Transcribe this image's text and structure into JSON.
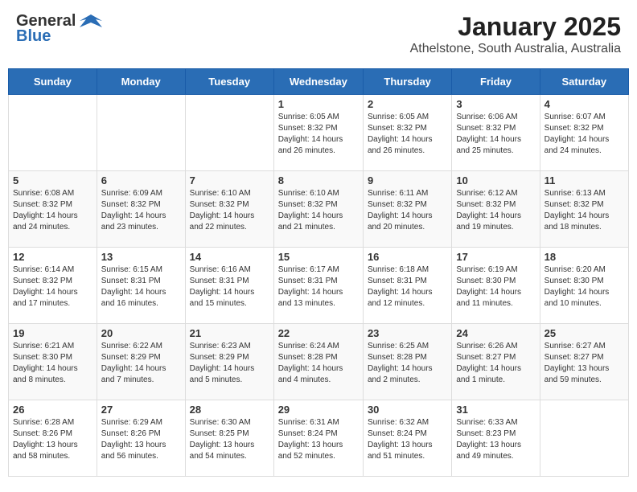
{
  "header": {
    "logo_general": "General",
    "logo_blue": "Blue",
    "month_title": "January 2025",
    "location": "Athelstone, South Australia, Australia"
  },
  "weekdays": [
    "Sunday",
    "Monday",
    "Tuesday",
    "Wednesday",
    "Thursday",
    "Friday",
    "Saturday"
  ],
  "weeks": [
    [
      {
        "day": null,
        "info": null
      },
      {
        "day": null,
        "info": null
      },
      {
        "day": null,
        "info": null
      },
      {
        "day": "1",
        "info": "Sunrise: 6:05 AM\nSunset: 8:32 PM\nDaylight: 14 hours\nand 26 minutes."
      },
      {
        "day": "2",
        "info": "Sunrise: 6:05 AM\nSunset: 8:32 PM\nDaylight: 14 hours\nand 26 minutes."
      },
      {
        "day": "3",
        "info": "Sunrise: 6:06 AM\nSunset: 8:32 PM\nDaylight: 14 hours\nand 25 minutes."
      },
      {
        "day": "4",
        "info": "Sunrise: 6:07 AM\nSunset: 8:32 PM\nDaylight: 14 hours\nand 24 minutes."
      }
    ],
    [
      {
        "day": "5",
        "info": "Sunrise: 6:08 AM\nSunset: 8:32 PM\nDaylight: 14 hours\nand 24 minutes."
      },
      {
        "day": "6",
        "info": "Sunrise: 6:09 AM\nSunset: 8:32 PM\nDaylight: 14 hours\nand 23 minutes."
      },
      {
        "day": "7",
        "info": "Sunrise: 6:10 AM\nSunset: 8:32 PM\nDaylight: 14 hours\nand 22 minutes."
      },
      {
        "day": "8",
        "info": "Sunrise: 6:10 AM\nSunset: 8:32 PM\nDaylight: 14 hours\nand 21 minutes."
      },
      {
        "day": "9",
        "info": "Sunrise: 6:11 AM\nSunset: 8:32 PM\nDaylight: 14 hours\nand 20 minutes."
      },
      {
        "day": "10",
        "info": "Sunrise: 6:12 AM\nSunset: 8:32 PM\nDaylight: 14 hours\nand 19 minutes."
      },
      {
        "day": "11",
        "info": "Sunrise: 6:13 AM\nSunset: 8:32 PM\nDaylight: 14 hours\nand 18 minutes."
      }
    ],
    [
      {
        "day": "12",
        "info": "Sunrise: 6:14 AM\nSunset: 8:32 PM\nDaylight: 14 hours\nand 17 minutes."
      },
      {
        "day": "13",
        "info": "Sunrise: 6:15 AM\nSunset: 8:31 PM\nDaylight: 14 hours\nand 16 minutes."
      },
      {
        "day": "14",
        "info": "Sunrise: 6:16 AM\nSunset: 8:31 PM\nDaylight: 14 hours\nand 15 minutes."
      },
      {
        "day": "15",
        "info": "Sunrise: 6:17 AM\nSunset: 8:31 PM\nDaylight: 14 hours\nand 13 minutes."
      },
      {
        "day": "16",
        "info": "Sunrise: 6:18 AM\nSunset: 8:31 PM\nDaylight: 14 hours\nand 12 minutes."
      },
      {
        "day": "17",
        "info": "Sunrise: 6:19 AM\nSunset: 8:30 PM\nDaylight: 14 hours\nand 11 minutes."
      },
      {
        "day": "18",
        "info": "Sunrise: 6:20 AM\nSunset: 8:30 PM\nDaylight: 14 hours\nand 10 minutes."
      }
    ],
    [
      {
        "day": "19",
        "info": "Sunrise: 6:21 AM\nSunset: 8:30 PM\nDaylight: 14 hours\nand 8 minutes."
      },
      {
        "day": "20",
        "info": "Sunrise: 6:22 AM\nSunset: 8:29 PM\nDaylight: 14 hours\nand 7 minutes."
      },
      {
        "day": "21",
        "info": "Sunrise: 6:23 AM\nSunset: 8:29 PM\nDaylight: 14 hours\nand 5 minutes."
      },
      {
        "day": "22",
        "info": "Sunrise: 6:24 AM\nSunset: 8:28 PM\nDaylight: 14 hours\nand 4 minutes."
      },
      {
        "day": "23",
        "info": "Sunrise: 6:25 AM\nSunset: 8:28 PM\nDaylight: 14 hours\nand 2 minutes."
      },
      {
        "day": "24",
        "info": "Sunrise: 6:26 AM\nSunset: 8:27 PM\nDaylight: 14 hours\nand 1 minute."
      },
      {
        "day": "25",
        "info": "Sunrise: 6:27 AM\nSunset: 8:27 PM\nDaylight: 13 hours\nand 59 minutes."
      }
    ],
    [
      {
        "day": "26",
        "info": "Sunrise: 6:28 AM\nSunset: 8:26 PM\nDaylight: 13 hours\nand 58 minutes."
      },
      {
        "day": "27",
        "info": "Sunrise: 6:29 AM\nSunset: 8:26 PM\nDaylight: 13 hours\nand 56 minutes."
      },
      {
        "day": "28",
        "info": "Sunrise: 6:30 AM\nSunset: 8:25 PM\nDaylight: 13 hours\nand 54 minutes."
      },
      {
        "day": "29",
        "info": "Sunrise: 6:31 AM\nSunset: 8:24 PM\nDaylight: 13 hours\nand 52 minutes."
      },
      {
        "day": "30",
        "info": "Sunrise: 6:32 AM\nSunset: 8:24 PM\nDaylight: 13 hours\nand 51 minutes."
      },
      {
        "day": "31",
        "info": "Sunrise: 6:33 AM\nSunset: 8:23 PM\nDaylight: 13 hours\nand 49 minutes."
      },
      {
        "day": null,
        "info": null
      }
    ]
  ]
}
